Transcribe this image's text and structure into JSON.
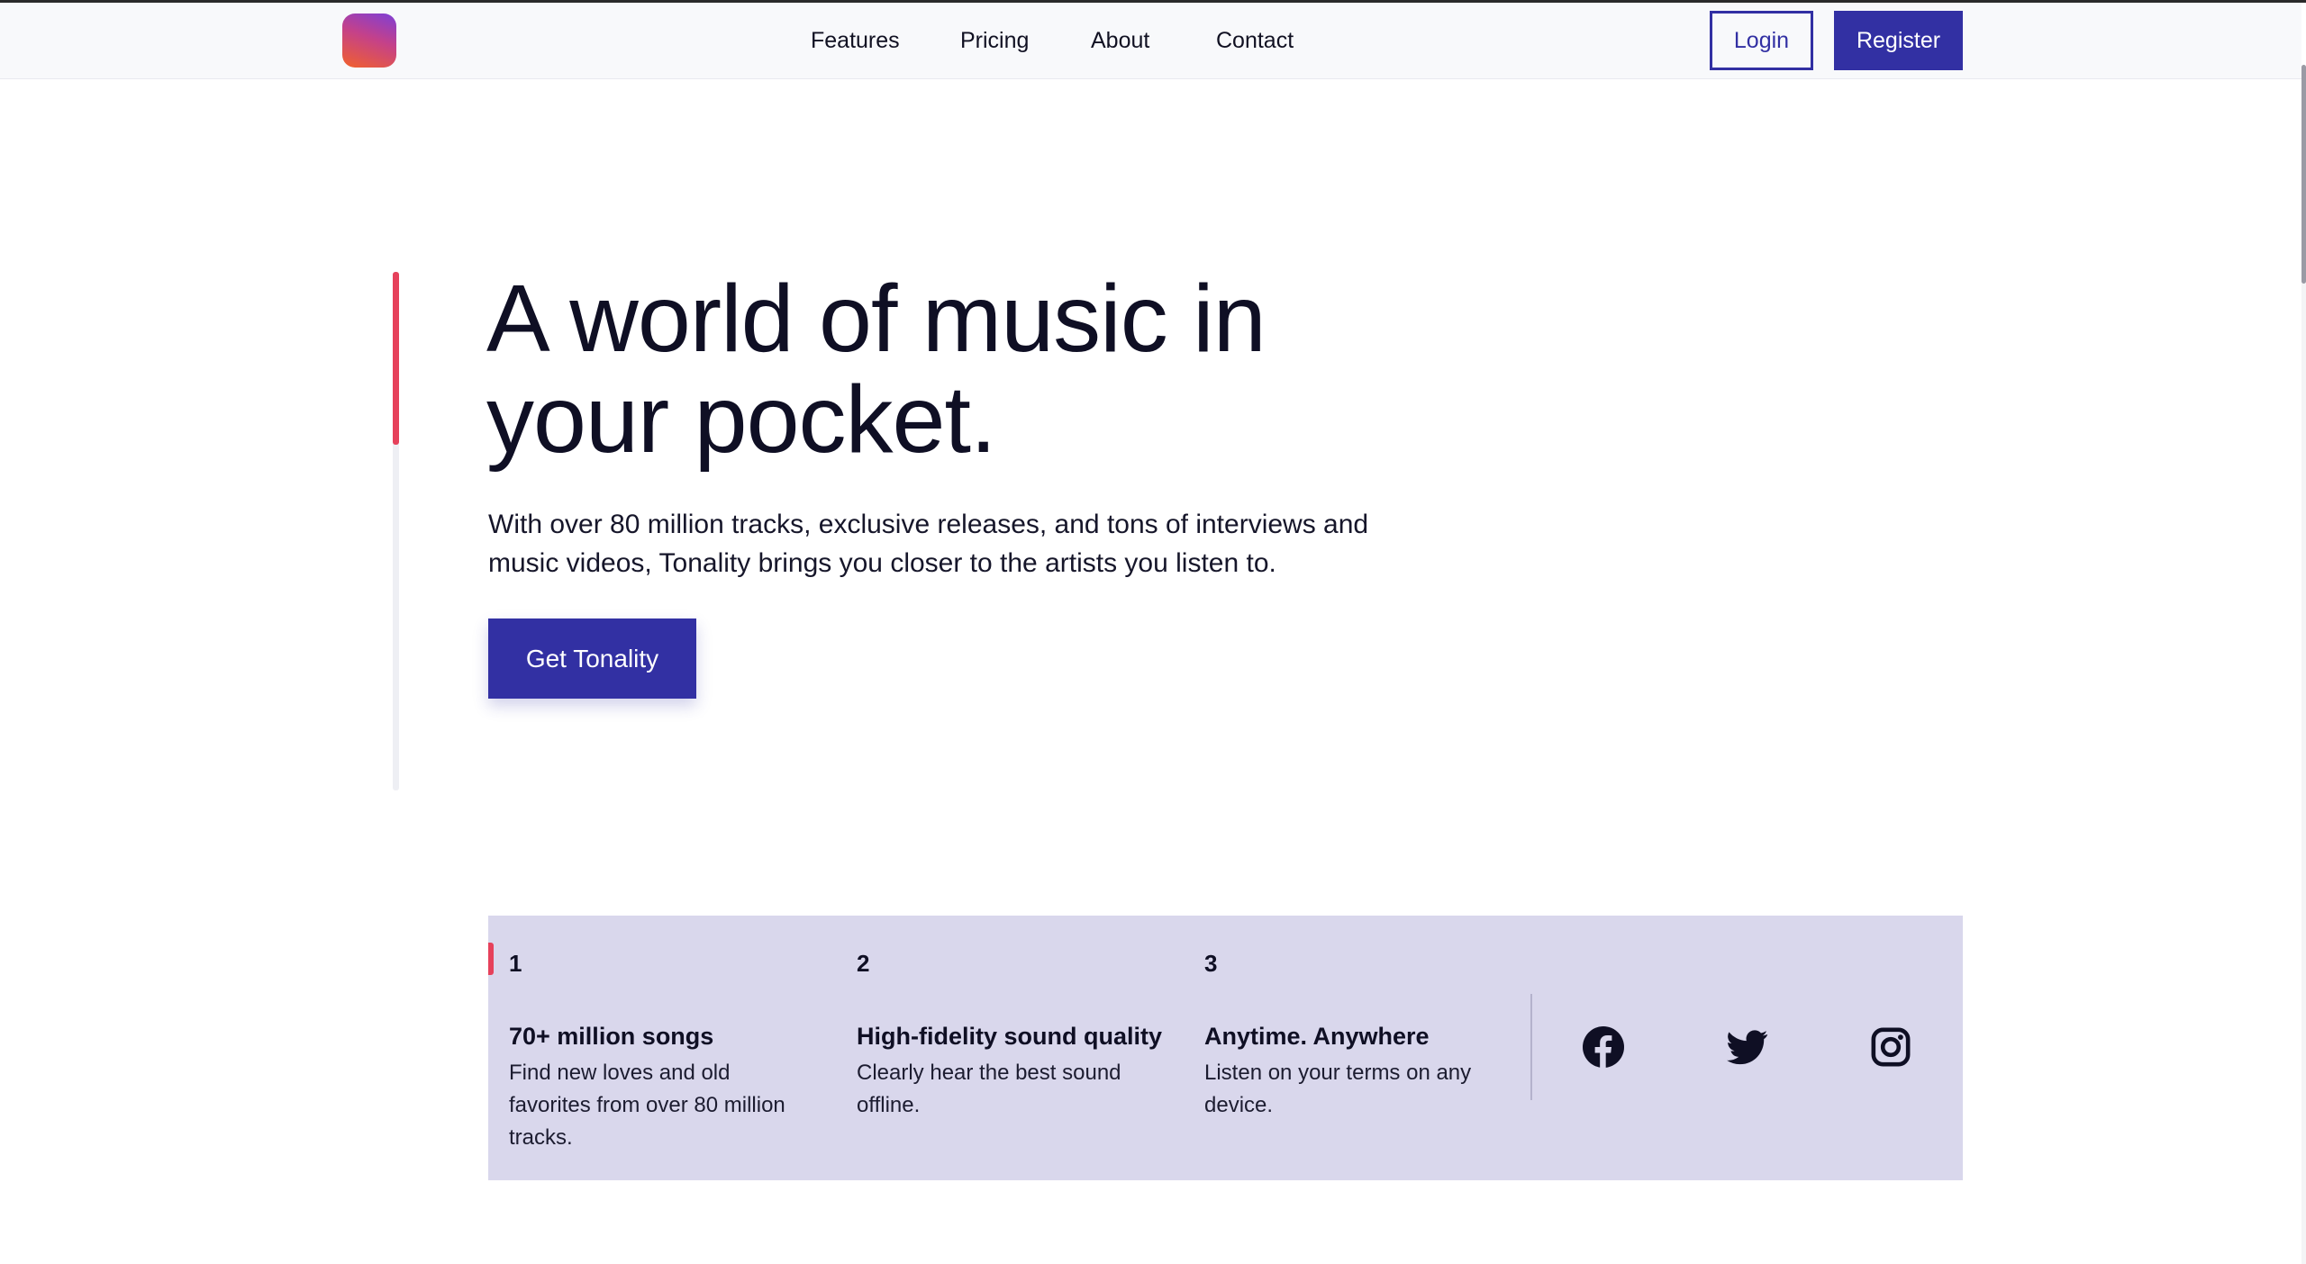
{
  "header": {
    "nav": [
      "Features",
      "Pricing",
      "About",
      "Contact"
    ],
    "login_label": "Login",
    "register_label": "Register"
  },
  "hero": {
    "title": "A world of music in your pocket.",
    "subtitle": "With over 80 million tracks, exclusive releases, and tons of interviews and music videos, Tonality brings you closer to the artists you listen to.",
    "cta_label": "Get Tonality"
  },
  "features": [
    {
      "number": "1",
      "title": "70+ million songs",
      "description": "Find new loves and old favorites from over 80 million tracks."
    },
    {
      "number": "2",
      "title": "High-fidelity sound quality",
      "description": "Clearly hear the best sound offline."
    },
    {
      "number": "3",
      "title": "Anytime. Anywhere",
      "description": "Listen on your terms on any device."
    }
  ],
  "social": [
    "facebook-icon",
    "twitter-icon",
    "instagram-icon"
  ],
  "colors": {
    "accent": "#3230a3",
    "highlight": "#e6415b",
    "panel": "#d9d7ec"
  }
}
